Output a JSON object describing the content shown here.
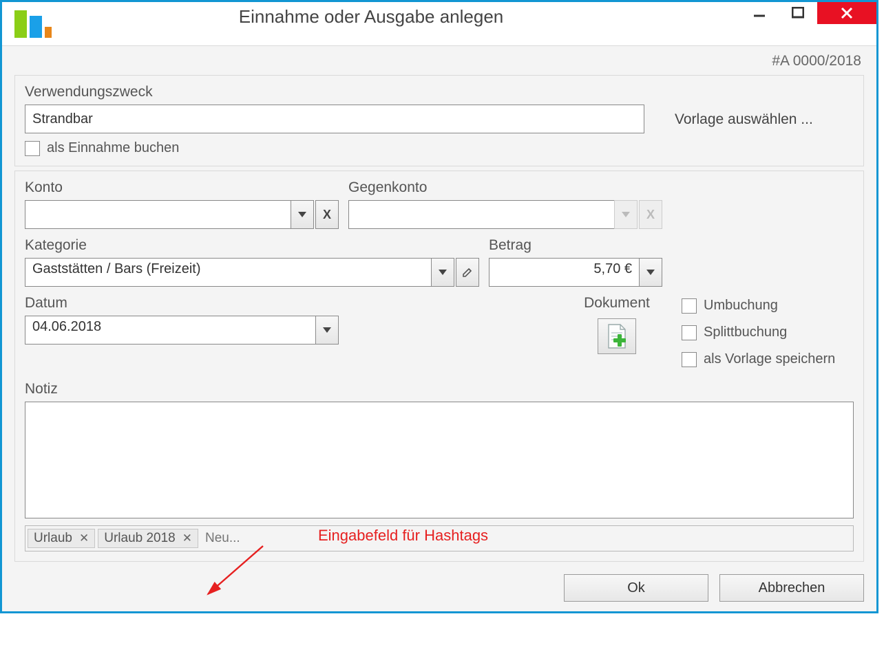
{
  "window": {
    "title": "Einnahme oder Ausgabe anlegen",
    "doc_id": "#A 0000/2018"
  },
  "labels": {
    "purpose": "Verwendungszweck",
    "book_as_income": "als Einnahme buchen",
    "account": "Konto",
    "counter_account": "Gegenkonto",
    "category": "Kategorie",
    "amount": "Betrag",
    "date": "Datum",
    "document": "Dokument",
    "transfer": "Umbuchung",
    "split": "Splittbuchung",
    "save_template": "als Vorlage speichern",
    "notes": "Notiz",
    "select_template": "Vorlage auswählen ...",
    "clear": "X"
  },
  "values": {
    "purpose": "Strandbar",
    "account": "",
    "counter_account": "",
    "category": "Gaststätten / Bars (Freizeit)",
    "amount": "5,70 €",
    "date": "04.06.2018",
    "notes": ""
  },
  "tags": {
    "items": [
      "Urlaub",
      "Urlaub 2018"
    ],
    "placeholder": "Neu..."
  },
  "buttons": {
    "ok": "Ok",
    "cancel": "Abbrechen"
  },
  "annotation": {
    "text": "Eingabefeld für Hashtags"
  }
}
